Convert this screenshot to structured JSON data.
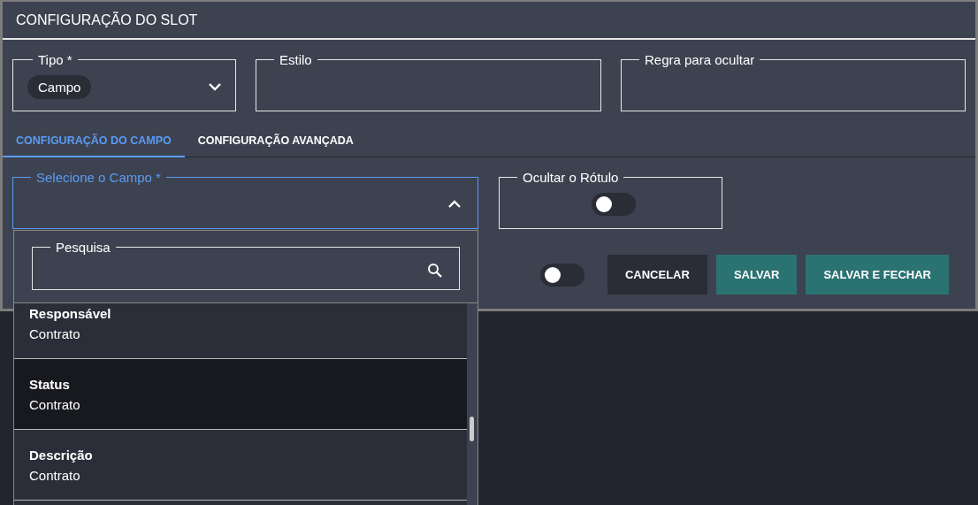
{
  "dialog": {
    "title": "CONFIGURAÇÃO DO SLOT"
  },
  "fields": [
    {
      "kind": "select",
      "label": "Tipo *",
      "chip": "Campo",
      "expanded": false
    },
    {
      "kind": "text",
      "label": "Estilo"
    },
    {
      "kind": "text",
      "label": "Regra para ocultar"
    }
  ],
  "tabs": [
    {
      "label": "CONFIGURAÇÃO DO CAMPO",
      "selected": true
    },
    {
      "label": "CONFIGURAÇÃO AVANÇADA",
      "selected": false
    }
  ],
  "field_select": {
    "label": "Selecione o Campo *",
    "expanded": true
  },
  "hide_label": {
    "label": "Ocultar o Rótulo",
    "on": false
  },
  "footer_toggle": {
    "on": false
  },
  "buttons": [
    {
      "label": "CANCELAR",
      "kind": "secondary"
    },
    {
      "label": "SALVAR",
      "kind": "primary"
    },
    {
      "label": "SALVAR E FECHAR",
      "kind": "primary"
    }
  ],
  "dropdown": {
    "search_label": "Pesquisa",
    "options": [
      {
        "title": "Responsável",
        "subtitle": "Contrato",
        "selected": false
      },
      {
        "title": "Status",
        "subtitle": "Contrato",
        "selected": true
      },
      {
        "title": "Descrição",
        "subtitle": "Contrato",
        "selected": false
      }
    ]
  }
}
